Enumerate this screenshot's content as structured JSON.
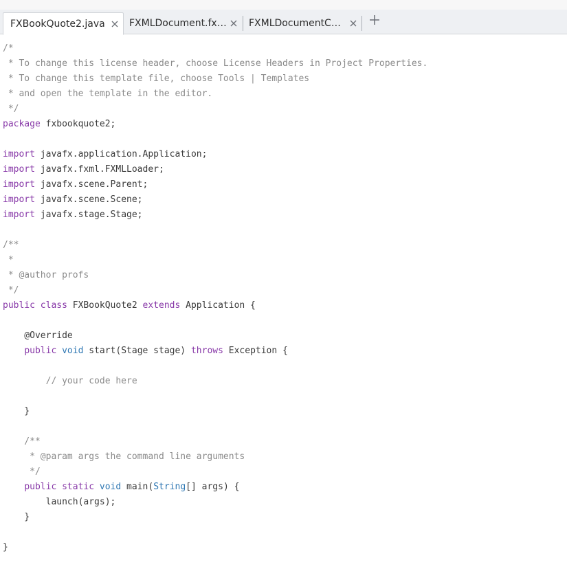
{
  "tabs": [
    {
      "label": "FXBookQuote2.java",
      "active": true
    },
    {
      "label": "FXMLDocument.fxml",
      "active": false
    },
    {
      "label": "FXMLDocumentController.java",
      "display": "FXMLDocumentCo...",
      "active": false
    }
  ],
  "icons": {
    "close": "close-icon",
    "add": "plus-icon"
  },
  "colors": {
    "keyword": "#8839a8",
    "type": "#2e77b3",
    "comment": "#8a8a8a",
    "text": "#3a3a3a"
  },
  "code": {
    "lines": [
      [
        {
          "t": "/*",
          "k": "comment"
        }
      ],
      [
        {
          "t": " * To change this license header, choose License Headers in Project Properties.",
          "k": "comment"
        }
      ],
      [
        {
          "t": " * To change this template file, choose Tools | Templates",
          "k": "comment"
        }
      ],
      [
        {
          "t": " * and open the template in the editor.",
          "k": "comment"
        }
      ],
      [
        {
          "t": " */",
          "k": "comment"
        }
      ],
      [
        {
          "t": "package",
          "k": "keyword"
        },
        {
          "t": " fxbookquote2;",
          "k": "plain"
        }
      ],
      [],
      [
        {
          "t": "import",
          "k": "keyword"
        },
        {
          "t": " javafx.application.Application;",
          "k": "plain"
        }
      ],
      [
        {
          "t": "import",
          "k": "keyword"
        },
        {
          "t": " javafx.fxml.FXMLLoader;",
          "k": "plain"
        }
      ],
      [
        {
          "t": "import",
          "k": "keyword"
        },
        {
          "t": " javafx.scene.Parent;",
          "k": "plain"
        }
      ],
      [
        {
          "t": "import",
          "k": "keyword"
        },
        {
          "t": " javafx.scene.Scene;",
          "k": "plain"
        }
      ],
      [
        {
          "t": "import",
          "k": "keyword"
        },
        {
          "t": " javafx.stage.Stage;",
          "k": "plain"
        }
      ],
      [],
      [
        {
          "t": "/**",
          "k": "comment"
        }
      ],
      [
        {
          "t": " *",
          "k": "comment"
        }
      ],
      [
        {
          "t": " * @author profs",
          "k": "comment"
        }
      ],
      [
        {
          "t": " */",
          "k": "comment"
        }
      ],
      [
        {
          "t": "public",
          "k": "keyword"
        },
        {
          "t": " ",
          "k": "plain"
        },
        {
          "t": "class",
          "k": "keyword"
        },
        {
          "t": " FXBookQuote2 ",
          "k": "plain"
        },
        {
          "t": "extends",
          "k": "keyword"
        },
        {
          "t": " Application {",
          "k": "plain"
        }
      ],
      [],
      [
        {
          "t": "    @Override",
          "k": "plain"
        }
      ],
      [
        {
          "t": "    ",
          "k": "plain"
        },
        {
          "t": "public",
          "k": "keyword"
        },
        {
          "t": " ",
          "k": "plain"
        },
        {
          "t": "void",
          "k": "type"
        },
        {
          "t": " start(Stage stage) ",
          "k": "plain"
        },
        {
          "t": "throws",
          "k": "keyword"
        },
        {
          "t": " Exception {",
          "k": "plain"
        }
      ],
      [],
      [
        {
          "t": "        // your code here",
          "k": "comment"
        }
      ],
      [],
      [
        {
          "t": "    }",
          "k": "plain"
        }
      ],
      [],
      [
        {
          "t": "    /**",
          "k": "comment"
        }
      ],
      [
        {
          "t": "     * @param args the command line arguments",
          "k": "comment"
        }
      ],
      [
        {
          "t": "     */",
          "k": "comment"
        }
      ],
      [
        {
          "t": "    ",
          "k": "plain"
        },
        {
          "t": "public",
          "k": "keyword"
        },
        {
          "t": " ",
          "k": "plain"
        },
        {
          "t": "static",
          "k": "keyword"
        },
        {
          "t": " ",
          "k": "plain"
        },
        {
          "t": "void",
          "k": "type"
        },
        {
          "t": " main(",
          "k": "plain"
        },
        {
          "t": "String",
          "k": "type"
        },
        {
          "t": "[] args) {",
          "k": "plain"
        }
      ],
      [
        {
          "t": "        launch(args);",
          "k": "plain"
        }
      ],
      [
        {
          "t": "    }",
          "k": "plain"
        }
      ],
      [],
      [
        {
          "t": "}",
          "k": "plain"
        }
      ]
    ]
  }
}
